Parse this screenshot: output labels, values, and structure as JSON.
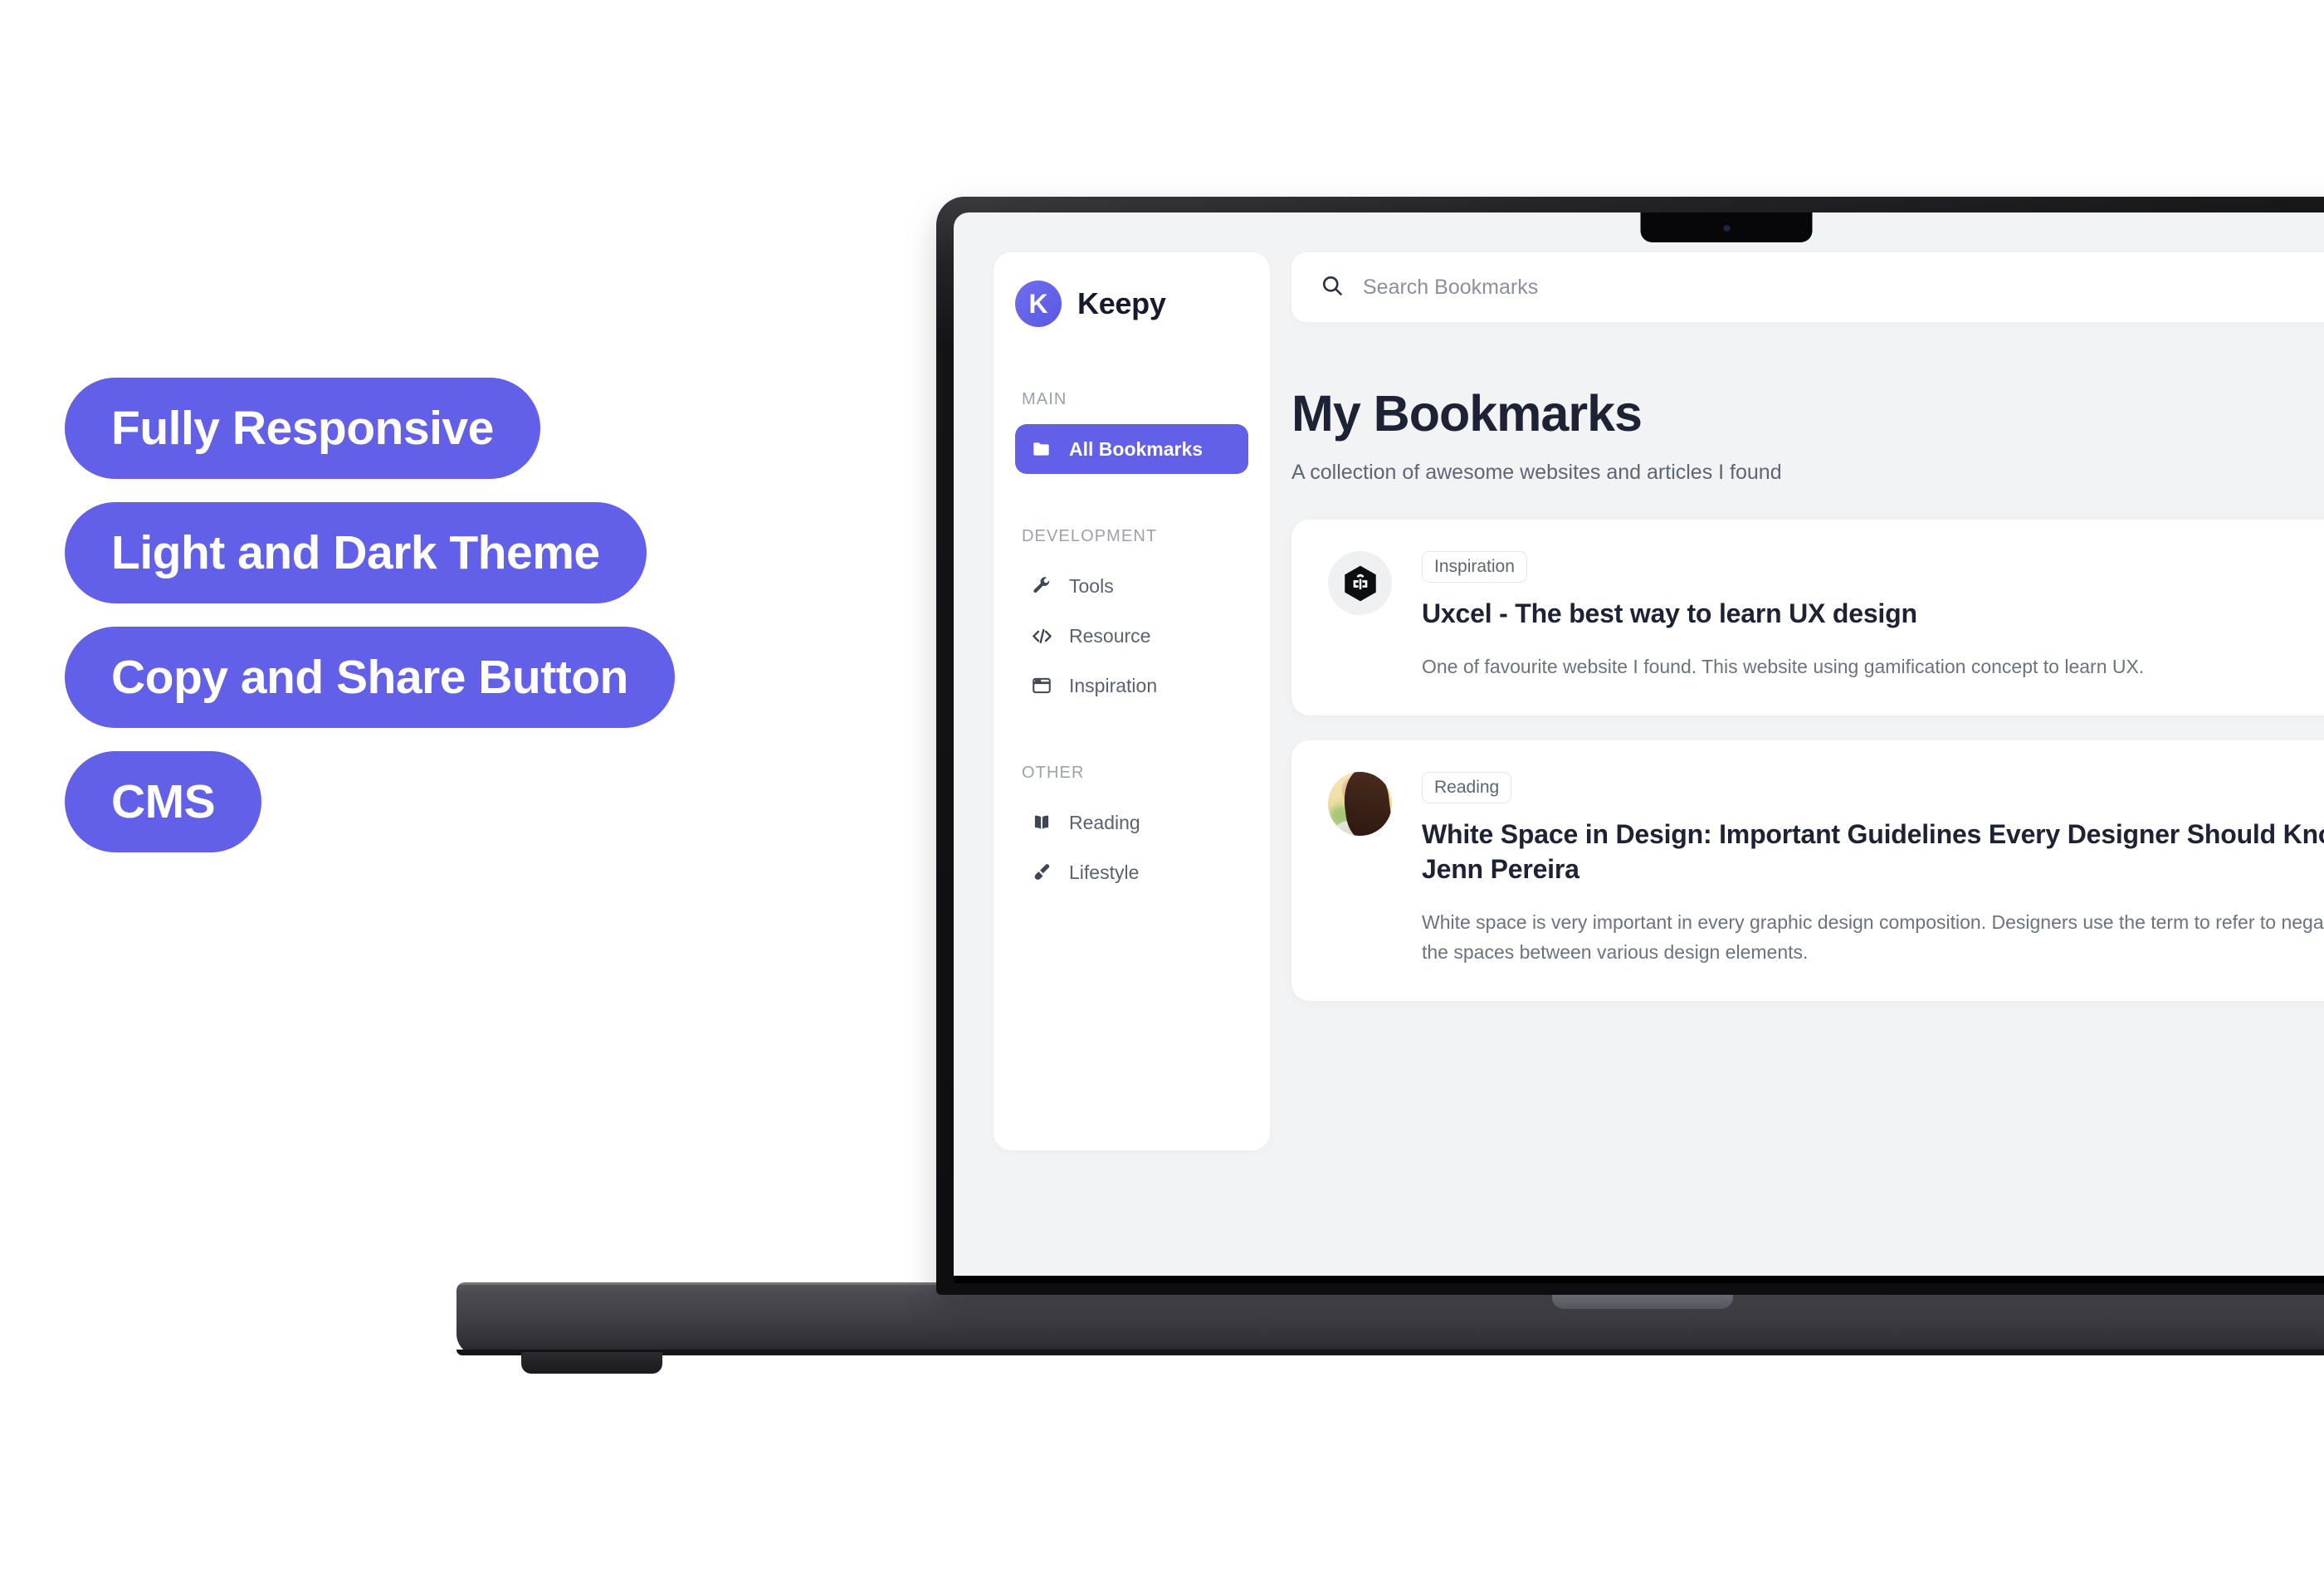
{
  "features": [
    {
      "label": "Fully Responsive"
    },
    {
      "label": "Light and Dark Theme"
    },
    {
      "label": "Copy and Share Button"
    },
    {
      "label": "CMS"
    }
  ],
  "theme": {
    "accent": "#6260E8",
    "app_background": "#F2F3F5",
    "card_background": "#FFFFFF",
    "title_color": "#1D2235",
    "muted_text": "#6B7280"
  },
  "app": {
    "brand": {
      "mark_letter": "K",
      "name": "Keepy"
    },
    "search": {
      "placeholder": "Search Bookmarks",
      "value": "",
      "icon": "search-icon"
    },
    "sidebar": {
      "groups": [
        {
          "label": "MAIN",
          "items": [
            {
              "label": "All Bookmarks",
              "icon": "folder-icon",
              "active": true
            }
          ]
        },
        {
          "label": "DEVELOPMENT",
          "items": [
            {
              "label": "Tools",
              "icon": "wrench-icon",
              "active": false
            },
            {
              "label": "Resource",
              "icon": "code-icon",
              "active": false
            },
            {
              "label": "Inspiration",
              "icon": "browser-window-icon",
              "active": false
            }
          ]
        },
        {
          "label": "OTHER",
          "items": [
            {
              "label": "Reading",
              "icon": "open-book-icon",
              "active": false
            },
            {
              "label": "Lifestyle",
              "icon": "paintbrush-icon",
              "active": false
            }
          ]
        }
      ]
    },
    "main": {
      "title": "My Bookmarks",
      "subtitle": "A collection of awesome websites and articles I found",
      "bookmarks": [
        {
          "tag": "Inspiration",
          "title": "Uxcel - The best way to learn UX design",
          "description": "One of favourite website I found. This website using gamification concept to learn UX.",
          "thumb": "uxcel-hexagon-logo",
          "action_icon": "share-icon"
        },
        {
          "tag": "Reading",
          "title": "White Space in Design: Important Guidelines Every Designer Should Know by Jenn Pereira",
          "title_line1": "White Space in Design: Important Guidelines Every Designer Should",
          "title_line2": "Know by Jenn Pereira",
          "description": "White space is very important in every graphic design composition. Designers use the term to refer to negative space or the spaces between various design elements.",
          "thumb": "author-avatar-photo",
          "action_icon": "share-icon"
        }
      ]
    }
  }
}
